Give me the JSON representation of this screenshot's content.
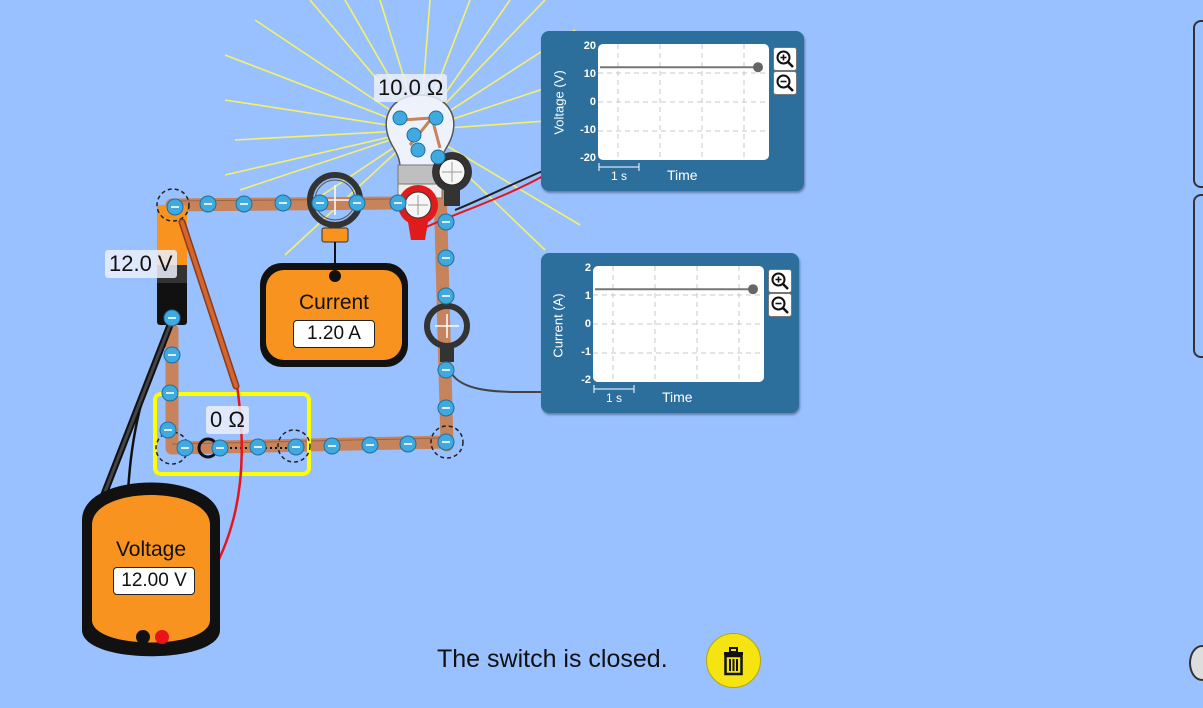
{
  "circuit": {
    "battery_voltage": "12.0 V",
    "bulb_resistance": "10.0 Ω",
    "switch_resistance": "0 Ω",
    "bulb_lit": true
  },
  "ammeter": {
    "title": "Current",
    "value": "1.20 A"
  },
  "voltmeter": {
    "title": "Voltage",
    "value": "12.00 V"
  },
  "voltage_chart": {
    "ylabel": "Voltage (V)",
    "xlabel": "Time",
    "scale_label": "1 s",
    "ticks": [
      "20",
      "10",
      "0",
      "-10",
      "-20"
    ]
  },
  "current_chart": {
    "ylabel": "Current (A)",
    "xlabel": "Time",
    "scale_label": "1 s",
    "ticks": [
      "2",
      "1",
      "0",
      "-1",
      "-2"
    ]
  },
  "chart_data": [
    {
      "type": "line",
      "title": "",
      "xlabel": "Time",
      "ylabel": "Voltage (V)",
      "ylim": [
        -20,
        20
      ],
      "y_ticks": [
        20,
        10,
        0,
        -10,
        -20
      ],
      "series": [
        {
          "values": [
            12,
            12
          ]
        }
      ],
      "grid": true
    },
    {
      "type": "line",
      "title": "",
      "xlabel": "Time",
      "ylabel": "Current (A)",
      "ylim": [
        -2,
        2
      ],
      "y_ticks": [
        2,
        1,
        0,
        -1,
        -2
      ],
      "series": [
        {
          "values": [
            1.2,
            1.2
          ]
        }
      ],
      "grid": true
    }
  ],
  "status": {
    "text": "The switch is closed."
  },
  "colors": {
    "background": "#99c0ff",
    "wire": "#c7835c",
    "meter_orange": "#f7931e",
    "chart_panel": "#2d6f9c",
    "selection_yellow": "#ffff00",
    "electron_blue": "#3fa9e0",
    "trash_yellow": "#f5e411"
  }
}
